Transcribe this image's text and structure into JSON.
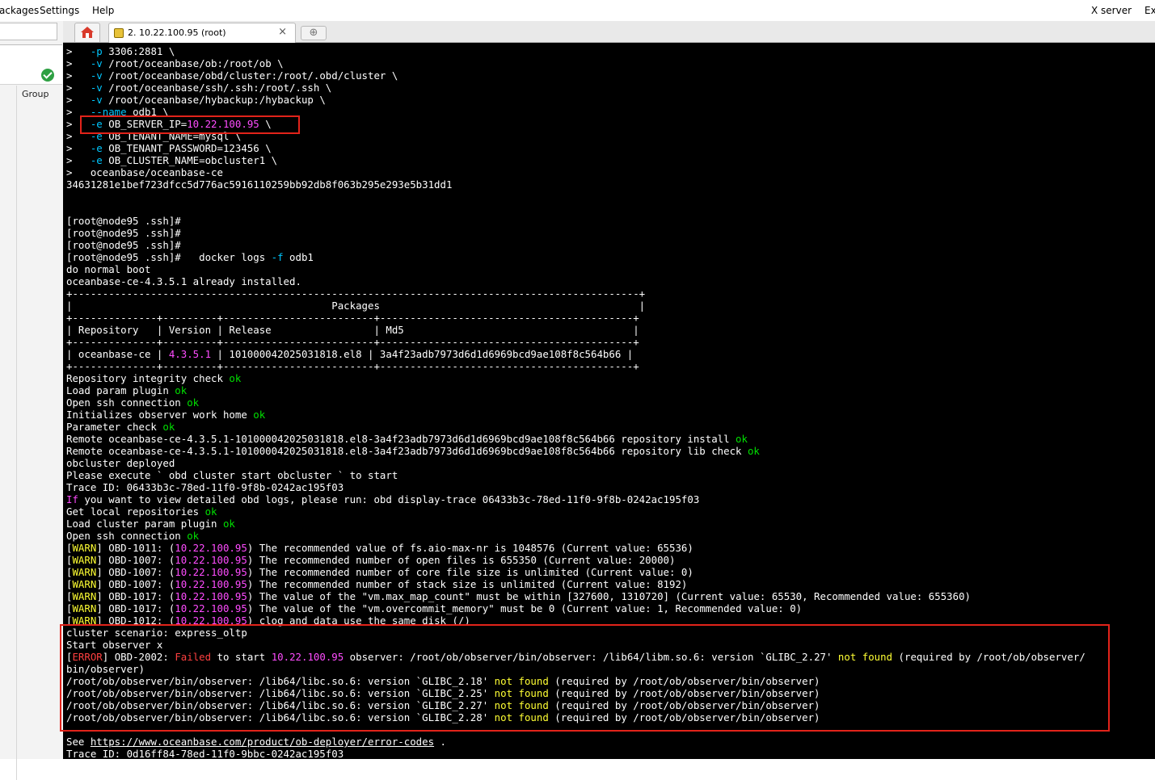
{
  "menu": {
    "packages": "ackages",
    "settings": "Settings",
    "help": "Help",
    "xserver": "X server",
    "exit": "Ex"
  },
  "sidebar": {
    "group_label": "Group"
  },
  "tabs": {
    "home_icon": "home-icon",
    "session_title": "2. 10.22.100.95 (root)",
    "close_glyph": "×",
    "new_tab_glyph": "⊕"
  },
  "colors": {
    "terminal_bg": "#000000",
    "ok": "#00e000",
    "flag": "#00c8ff",
    "ip": "#ff4cff",
    "warn": "#ffff33",
    "error": "#ff4040",
    "highlight_box": "#e2231a"
  },
  "terminal": {
    "lines": [
      [
        [
          "t",
          "> "
        ],
        [
          "c",
          "  -p "
        ],
        [
          "t",
          "3306:2881 \\"
        ]
      ],
      [
        [
          "t",
          "> "
        ],
        [
          "c",
          "  -v "
        ],
        [
          "t",
          "/root/oceanbase/ob:/root/ob \\"
        ]
      ],
      [
        [
          "t",
          "> "
        ],
        [
          "c",
          "  -v "
        ],
        [
          "t",
          "/root/oceanbase/obd/cluster:/root/.obd/cluster \\"
        ]
      ],
      [
        [
          "t",
          "> "
        ],
        [
          "c",
          "  -v "
        ],
        [
          "t",
          "/root/oceanbase/ssh/.ssh:/root/.ssh \\"
        ]
      ],
      [
        [
          "t",
          "> "
        ],
        [
          "c",
          "  -v "
        ],
        [
          "t",
          "/root/oceanbase/hybackup:/hybackup \\"
        ]
      ],
      [
        [
          "t",
          "> "
        ],
        [
          "c",
          "  --name "
        ],
        [
          "t",
          "odb1 \\"
        ]
      ],
      [
        [
          "t",
          "> "
        ],
        [
          "c",
          "  -e "
        ],
        [
          "t",
          "OB_SERVER_IP="
        ],
        [
          "m",
          "10.22.100.95"
        ],
        [
          "t",
          " \\"
        ]
      ],
      [
        [
          "t",
          "> "
        ],
        [
          "c",
          "  -e "
        ],
        [
          "t",
          "OB_TENANT_NAME=mysql \\"
        ]
      ],
      [
        [
          "t",
          "> "
        ],
        [
          "c",
          "  -e "
        ],
        [
          "t",
          "OB_TENANT_PASSWORD=123456 \\"
        ]
      ],
      [
        [
          "t",
          "> "
        ],
        [
          "c",
          "  -e "
        ],
        [
          "t",
          "OB_CLUSTER_NAME=obcluster1 \\"
        ]
      ],
      [
        [
          "t",
          ">   oceanbase/oceanbase-ce"
        ]
      ],
      [
        [
          "t",
          "34631281e1bef723dfcc5d776ac5916110259bb92db8f063b295e293e5b31dd1"
        ]
      ],
      [
        [
          "t",
          ""
        ]
      ],
      [
        [
          "t",
          ""
        ]
      ],
      [
        [
          "t",
          "[root@node95 .ssh]#"
        ]
      ],
      [
        [
          "t",
          "[root@node95 .ssh]#"
        ]
      ],
      [
        [
          "t",
          "[root@node95 .ssh]#"
        ]
      ],
      [
        [
          "t",
          "[root@node95 .ssh]#   docker logs "
        ],
        [
          "c",
          "-f"
        ],
        [
          "t",
          " odb1"
        ]
      ],
      [
        [
          "t",
          "do normal boot"
        ]
      ],
      [
        [
          "t",
          "oceanbase-ce-4.3.5.1 already installed."
        ]
      ],
      [
        [
          "t",
          "+----------------------------------------------------------------------------------------------+"
        ]
      ],
      [
        [
          "t",
          "|                                           Packages                                           |"
        ]
      ],
      [
        [
          "t",
          "+--------------+---------+-------------------------+------------------------------------------+"
        ]
      ],
      [
        [
          "t",
          "| Repository   | Version | Release                 | Md5                                      |"
        ]
      ],
      [
        [
          "t",
          "+--------------+---------+-------------------------+------------------------------------------+"
        ]
      ],
      [
        [
          "t",
          "| oceanbase-ce | "
        ],
        [
          "m",
          "4.3.5.1"
        ],
        [
          "t",
          " | 101000042025031818.el8 | 3a4f23adb7973d6d1d6969bcd9ae108f8c564b66 |"
        ]
      ],
      [
        [
          "t",
          "+--------------+---------+-------------------------+------------------------------------------+"
        ]
      ],
      [
        [
          "t",
          "Repository integrity check "
        ],
        [
          "g",
          "ok"
        ]
      ],
      [
        [
          "t",
          "Load param plugin "
        ],
        [
          "g",
          "ok"
        ]
      ],
      [
        [
          "t",
          "Open ssh connection "
        ],
        [
          "g",
          "ok"
        ]
      ],
      [
        [
          "t",
          "Initializes observer work home "
        ],
        [
          "g",
          "ok"
        ]
      ],
      [
        [
          "t",
          "Parameter check "
        ],
        [
          "g",
          "ok"
        ]
      ],
      [
        [
          "t",
          "Remote oceanbase-ce-4.3.5.1-101000042025031818.el8-3a4f23adb7973d6d1d6969bcd9ae108f8c564b66 repository install "
        ],
        [
          "g",
          "ok"
        ]
      ],
      [
        [
          "t",
          "Remote oceanbase-ce-4.3.5.1-101000042025031818.el8-3a4f23adb7973d6d1d6969bcd9ae108f8c564b66 repository lib check "
        ],
        [
          "g",
          "ok"
        ]
      ],
      [
        [
          "t",
          "obcluster deployed"
        ]
      ],
      [
        [
          "t",
          "Please execute ` obd cluster start obcluster ` to start"
        ]
      ],
      [
        [
          "t",
          "Trace ID: 06433b3c-78ed-11f0-9f8b-0242ac195f03"
        ]
      ],
      [
        [
          "m",
          "If"
        ],
        [
          "t",
          " you want to view detailed obd logs, please run: obd display-trace 06433b3c-78ed-11f0-9f8b-0242ac195f03"
        ]
      ],
      [
        [
          "t",
          "Get local repositories "
        ],
        [
          "g",
          "ok"
        ]
      ],
      [
        [
          "t",
          "Load cluster param plugin "
        ],
        [
          "g",
          "ok"
        ]
      ],
      [
        [
          "t",
          "Open ssh connection "
        ],
        [
          "g",
          "ok"
        ]
      ],
      [
        [
          "t",
          "["
        ],
        [
          "y",
          "WARN"
        ],
        [
          "t",
          "] OBD-1011: ("
        ],
        [
          "m",
          "10.22.100.95"
        ],
        [
          "t",
          ") The recommended value of fs.aio-max-nr is 1048576 (Current value: 65536)"
        ]
      ],
      [
        [
          "t",
          "["
        ],
        [
          "y",
          "WARN"
        ],
        [
          "t",
          "] OBD-1007: ("
        ],
        [
          "m",
          "10.22.100.95"
        ],
        [
          "t",
          ") The recommended number of open files is 655350 (Current value: 20000)"
        ]
      ],
      [
        [
          "t",
          "["
        ],
        [
          "y",
          "WARN"
        ],
        [
          "t",
          "] OBD-1007: ("
        ],
        [
          "m",
          "10.22.100.95"
        ],
        [
          "t",
          ") The recommended number of core file size is unlimited (Current value: 0)"
        ]
      ],
      [
        [
          "t",
          "["
        ],
        [
          "y",
          "WARN"
        ],
        [
          "t",
          "] OBD-1007: ("
        ],
        [
          "m",
          "10.22.100.95"
        ],
        [
          "t",
          ") The recommended number of stack size is unlimited (Current value: 8192)"
        ]
      ],
      [
        [
          "t",
          "["
        ],
        [
          "y",
          "WARN"
        ],
        [
          "t",
          "] OBD-1017: ("
        ],
        [
          "m",
          "10.22.100.95"
        ],
        [
          "t",
          ") The value of the \"vm.max_map_count\" must be within [327600, 1310720] (Current value: 65530, Recommended value: 655360)"
        ]
      ],
      [
        [
          "t",
          "["
        ],
        [
          "y",
          "WARN"
        ],
        [
          "t",
          "] OBD-1017: ("
        ],
        [
          "m",
          "10.22.100.95"
        ],
        [
          "t",
          ") The value of the \"vm.overcommit_memory\" must be 0 (Current value: 1, Recommended value: 0)"
        ]
      ],
      [
        [
          "t",
          "["
        ],
        [
          "y",
          "WARN"
        ],
        [
          "t",
          "] OBD-1012: ("
        ],
        [
          "m",
          "10.22.100.95"
        ],
        [
          "t",
          ") clog and data use the same disk (/)"
        ]
      ],
      [
        [
          "t",
          "cluster scenario: express_oltp"
        ]
      ],
      [
        [
          "t",
          "Start observer x"
        ]
      ],
      [
        [
          "t",
          "["
        ],
        [
          "r",
          "ERROR"
        ],
        [
          "t",
          "] OBD-2002: "
        ],
        [
          "r",
          "Failed"
        ],
        [
          "t",
          " to start "
        ],
        [
          "m",
          "10.22.100.95"
        ],
        [
          "t",
          " observer: /root/ob/observer/bin/observer: /lib64/libm.so.6: version `GLIBC_2.27' "
        ],
        [
          "y",
          "not found"
        ],
        [
          "t",
          " (required by /root/ob/observer/"
        ]
      ],
      [
        [
          "t",
          "bin/observer)"
        ]
      ],
      [
        [
          "t",
          "/root/ob/observer/bin/observer: /lib64/libc.so.6: version `GLIBC_2.18' "
        ],
        [
          "y",
          "not found"
        ],
        [
          "t",
          " (required by /root/ob/observer/bin/observer)"
        ]
      ],
      [
        [
          "t",
          "/root/ob/observer/bin/observer: /lib64/libc.so.6: version `GLIBC_2.25' "
        ],
        [
          "y",
          "not found"
        ],
        [
          "t",
          " (required by /root/ob/observer/bin/observer)"
        ]
      ],
      [
        [
          "t",
          "/root/ob/observer/bin/observer: /lib64/libc.so.6: version `GLIBC_2.27' "
        ],
        [
          "y",
          "not found"
        ],
        [
          "t",
          " (required by /root/ob/observer/bin/observer)"
        ]
      ],
      [
        [
          "t",
          "/root/ob/observer/bin/observer: /lib64/libc.so.6: version `GLIBC_2.28' "
        ],
        [
          "y",
          "not found"
        ],
        [
          "t",
          " (required by /root/ob/observer/bin/observer)"
        ]
      ],
      [
        [
          "t",
          ""
        ]
      ],
      [
        [
          "t",
          "See "
        ],
        [
          "u",
          "https://www.oceanbase.com/product/ob-deployer/error-codes"
        ],
        [
          "t",
          " ."
        ]
      ],
      [
        [
          "t",
          "Trace ID: 0d16ff84-78ed-11f0-9bbc-0242ac195f03"
        ]
      ]
    ]
  }
}
